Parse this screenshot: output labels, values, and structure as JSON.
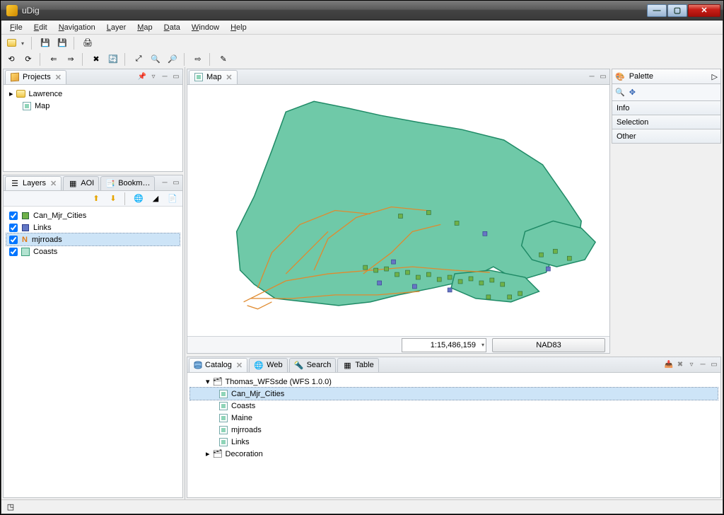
{
  "window": {
    "title": "uDig"
  },
  "menu": {
    "file": "File",
    "edit": "Edit",
    "navigation": "Navigation",
    "layer": "Layer",
    "map": "Map",
    "data": "Data",
    "window": "Window",
    "help": "Help"
  },
  "views": {
    "projects": {
      "title": "Projects"
    },
    "layers": {
      "title": "Layers"
    },
    "aoi": {
      "title": "AOI"
    },
    "bookmarks": {
      "title": "Bookm…"
    },
    "map_tab": {
      "title": "Map"
    },
    "palette": {
      "title": "Palette",
      "sections": {
        "info": "Info",
        "selection": "Selection",
        "other": "Other"
      }
    },
    "catalog": {
      "title": "Catalog"
    },
    "web": {
      "title": "Web"
    },
    "search": {
      "title": "Search"
    },
    "table": {
      "title": "Table"
    }
  },
  "project_tree": {
    "root": "Lawrence",
    "child": "Map"
  },
  "layers": [
    {
      "name": "Can_Mjr_Cities",
      "icon": "sq",
      "selected": false
    },
    {
      "name": "Links",
      "icon": "sqblue",
      "selected": false
    },
    {
      "name": "mjrroads",
      "icon": "road",
      "selected": true
    },
    {
      "name": "Coasts",
      "icon": "coast",
      "selected": false
    }
  ],
  "map_status": {
    "scale": "1:15,486,159",
    "proj": "NAD83"
  },
  "catalog_tree": {
    "service": "Thomas_WFSsde (WFS 1.0.0)",
    "layers": [
      "Can_Mjr_Cities",
      "Coasts",
      "Maine",
      "mjrroads",
      "Links"
    ],
    "decoration": "Decoration"
  }
}
